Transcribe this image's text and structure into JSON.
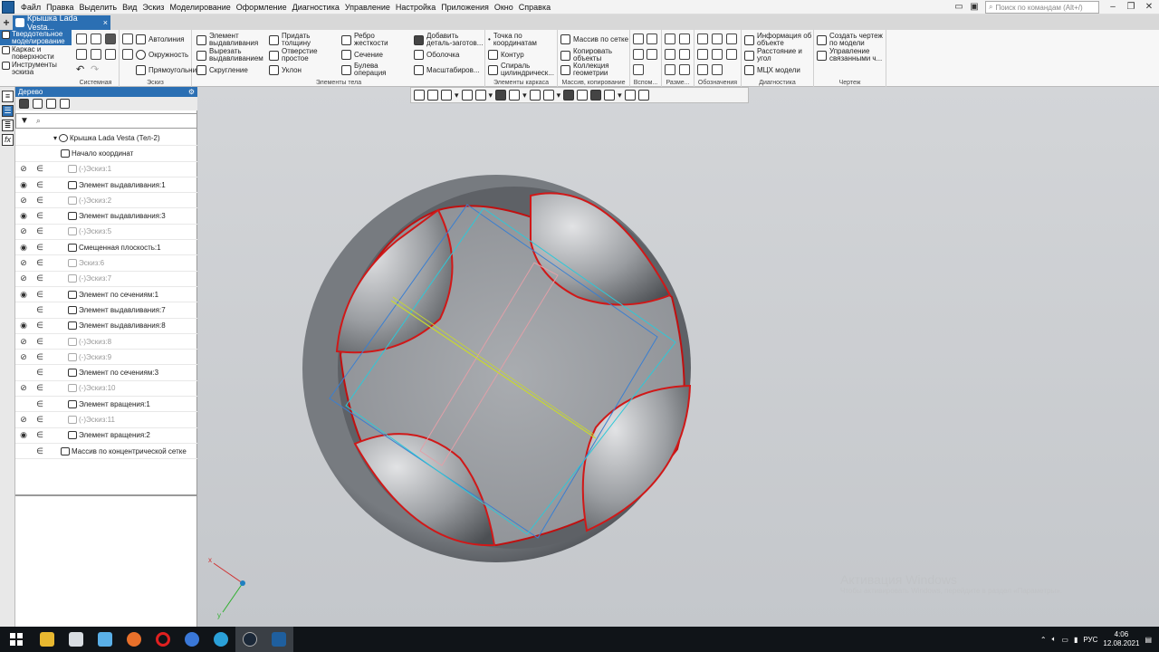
{
  "menubar": {
    "items": [
      "Файл",
      "Правка",
      "Выделить",
      "Вид",
      "Эскиз",
      "Моделирование",
      "Оформление",
      "Диагностика",
      "Управление",
      "Настройка",
      "Приложения",
      "Окно",
      "Справка"
    ],
    "search_placeholder": "Поиск по командам (Alt+/)"
  },
  "document_tab": {
    "title": "Крышка Lada Vesta...",
    "close": "×"
  },
  "ribbon": {
    "modes": [
      "Твердотельное моделирование",
      "Каркас и поверхности",
      "Инструменты эскиза"
    ],
    "groups": [
      {
        "label": "Системная"
      },
      {
        "label": "Эскиз"
      },
      {
        "label": "Элементы тела"
      },
      {
        "label": "Элементы каркаса"
      },
      {
        "label": "Массив, копирование"
      },
      {
        "label": "Вспом..."
      },
      {
        "label": "Разме..."
      },
      {
        "label": "Обозначения"
      },
      {
        "label": "Диагностика"
      },
      {
        "label": "Чертеж"
      }
    ],
    "tools": {
      "sketch": [
        "Автолиния",
        "Окружность",
        "Прямоугольник"
      ],
      "body_col1": [
        "Элемент выдавливания",
        "Вырезать выдавливанием",
        "Скругление"
      ],
      "body_col2": [
        "Придать толщину",
        "Отверстие простое",
        "Уклон"
      ],
      "body_col3": [
        "Ребро жесткости",
        "Сечение",
        "Булева операция"
      ],
      "body_col4": [
        "Добавить деталь-заготов...",
        "Оболочка",
        "Масштабиров..."
      ],
      "frame": [
        "Точка по координатам",
        "Контур",
        "Спираль цилиндрическ..."
      ],
      "array": [
        "Массив по сетке",
        "Копировать объекты",
        "Коллекция геометрии"
      ],
      "diag": [
        "Информация об объекте",
        "Расстояние и угол",
        "МЦХ модели"
      ],
      "drawing": [
        "Создать чертеж по модели",
        "Управление связанными ч..."
      ]
    }
  },
  "tree": {
    "title": "Дерево",
    "root": "Крышка Lada Vesta (Тел-2)",
    "rows": [
      {
        "label": "Начало координат",
        "eye": "",
        "link": "",
        "dim": false
      },
      {
        "label": "(-)Эскиз:1",
        "eye": "⊘",
        "link": "∈",
        "dim": true
      },
      {
        "label": "Элемент выдавливания:1",
        "eye": "◉",
        "link": "∈",
        "dim": false
      },
      {
        "label": "(-)Эскиз:2",
        "eye": "⊘",
        "link": "∈",
        "dim": true
      },
      {
        "label": "Элемент выдавливания:3",
        "eye": "◉",
        "link": "∈",
        "dim": false
      },
      {
        "label": "(-)Эскиз:5",
        "eye": "⊘",
        "link": "∈",
        "dim": true
      },
      {
        "label": "Смещенная плоскость:1",
        "eye": "◉",
        "link": "∈",
        "dim": false
      },
      {
        "label": "Эскиз:6",
        "eye": "⊘",
        "link": "∈",
        "dim": true
      },
      {
        "label": "(-)Эскиз:7",
        "eye": "⊘",
        "link": "∈",
        "dim": true
      },
      {
        "label": "Элемент по сечениям:1",
        "eye": "◉",
        "link": "∈",
        "dim": false
      },
      {
        "label": "Элемент выдавливания:7",
        "eye": "",
        "link": "∈",
        "dim": false
      },
      {
        "label": "Элемент выдавливания:8",
        "eye": "◉",
        "link": "∈",
        "dim": false
      },
      {
        "label": "(-)Эскиз:8",
        "eye": "⊘",
        "link": "∈",
        "dim": true
      },
      {
        "label": "(-)Эскиз:9",
        "eye": "⊘",
        "link": "∈",
        "dim": true
      },
      {
        "label": "Элемент по сечениям:3",
        "eye": "",
        "link": "∈",
        "dim": false
      },
      {
        "label": "(-)Эскиз:10",
        "eye": "⊘",
        "link": "∈",
        "dim": true
      },
      {
        "label": "Элемент вращения:1",
        "eye": "",
        "link": "∈",
        "dim": false
      },
      {
        "label": "(-)Эскиз:11",
        "eye": "⊘",
        "link": "∈",
        "dim": true
      },
      {
        "label": "Элемент вращения:2",
        "eye": "◉",
        "link": "∈",
        "dim": false
      },
      {
        "label": "Массив по концентрической сетке",
        "eye": "",
        "link": "∈",
        "dim": false
      }
    ]
  },
  "viewport": {
    "watermark": "Активация Windows",
    "watermark_sub": "Чтобы активировать Windows, перейдите в раздел «Параметры»."
  },
  "taskbar": {
    "tray_lang": "РУС",
    "time": "4:06",
    "date": "12.08.2021"
  },
  "colors": {
    "accent": "#2b6fb3",
    "edge_red": "#d01818",
    "sketch_blue": "#3a7fd0",
    "sketch_cyan": "#2ec8d8",
    "sketch_yellow": "#c8d830",
    "sketch_pink": "#e0a0a8"
  }
}
